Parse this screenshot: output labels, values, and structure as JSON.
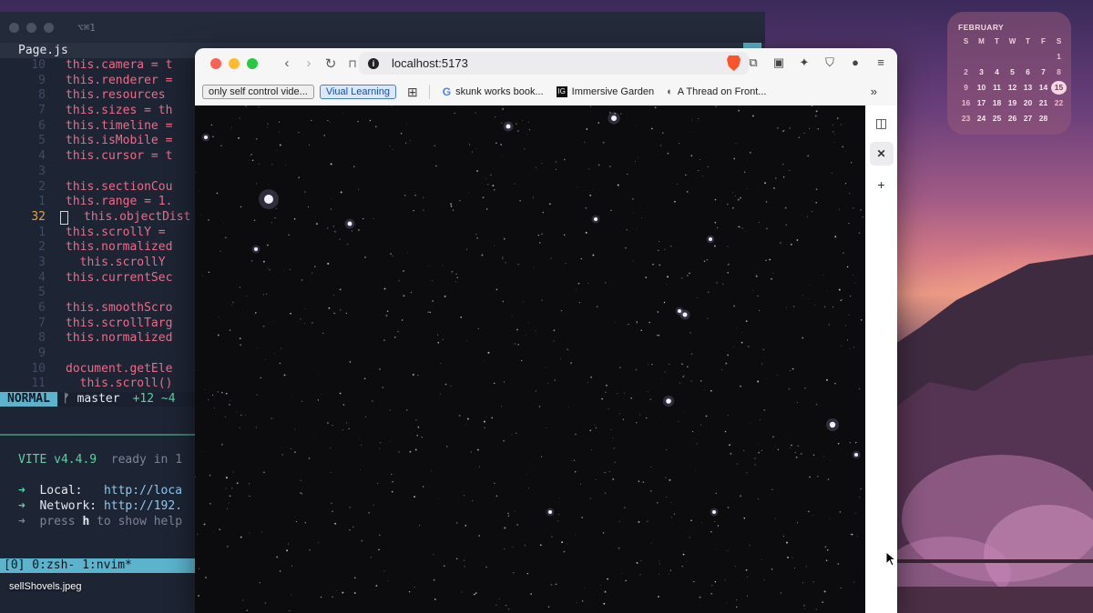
{
  "calendar": {
    "month": "FEBRUARY",
    "weekdays": [
      "S",
      "M",
      "T",
      "W",
      "T",
      "F",
      "S"
    ],
    "rows": [
      [
        "",
        "",
        "",
        "",
        "",
        "",
        "1"
      ],
      [
        "2",
        "3",
        "4",
        "5",
        "6",
        "7",
        "8"
      ],
      [
        "9",
        "10",
        "11",
        "12",
        "13",
        "14",
        "15"
      ],
      [
        "16",
        "17",
        "18",
        "19",
        "20",
        "21",
        "22"
      ],
      [
        "23",
        "24",
        "25",
        "26",
        "27",
        "28",
        ""
      ]
    ],
    "today": "15"
  },
  "terminal": {
    "title": "⌥⌘1",
    "tab": "Page.js",
    "lines": [
      {
        "num": "10",
        "sign": "",
        "code": "this.camera = t"
      },
      {
        "num": "9",
        "sign": "",
        "code": "this.renderer ="
      },
      {
        "num": "8",
        "sign": "",
        "code": "this.resources"
      },
      {
        "num": "7",
        "sign": "",
        "code": "this.sizes = th"
      },
      {
        "num": "6",
        "sign": "",
        "code": "this.timeline ="
      },
      {
        "num": "5",
        "sign": "",
        "code": "this.isMobile ="
      },
      {
        "num": "4",
        "sign": "",
        "code": "this.cursor = t"
      },
      {
        "num": "3",
        "sign": "",
        "code": ""
      },
      {
        "num": "2",
        "sign": "",
        "code": "this.sectionCou"
      },
      {
        "num": "1",
        "sign": "",
        "code": "this.range = 1."
      },
      {
        "num": "32",
        "sign": "",
        "code": "this.objectDist",
        "current": true
      },
      {
        "num": "1",
        "sign": "",
        "code": "this.scrollY ="
      },
      {
        "num": "2",
        "sign": "",
        "code": "this.normalized"
      },
      {
        "num": "3",
        "sign": "",
        "code": "  this.scrollY"
      },
      {
        "num": "4",
        "sign": "",
        "code": "this.currentSec"
      },
      {
        "num": "5",
        "sign": "",
        "code": ""
      },
      {
        "num": "6",
        "sign": "",
        "code": "this.smoothScro"
      },
      {
        "num": "7",
        "sign": "",
        "code": "this.scrollTarg"
      },
      {
        "num": "8",
        "sign": "",
        "code": "this.normalized"
      },
      {
        "num": "9",
        "sign": "",
        "code": ""
      },
      {
        "num": "10",
        "sign": "H",
        "code": "document.getEle"
      },
      {
        "num": "11",
        "sign": "",
        "code": "  this.scroll()"
      }
    ],
    "status": {
      "mode": "NORMAL",
      "branch": "ᚠ master",
      "diff": "+12 ~4"
    },
    "vite": {
      "name": "VITE v4.4.9",
      "ready": "ready in 1",
      "local_label": "Local:",
      "local_url": "http://loca",
      "network_label": "Network:",
      "network_url": "http://192.",
      "press_pre": "press ",
      "press_key": "h",
      "press_post": " to show help"
    },
    "tmux": "[0] 0:zsh- 1:nvim*"
  },
  "browser": {
    "url": "localhost:5173",
    "bookmarks": [
      {
        "label": "only self control vide...",
        "style": "pill"
      },
      {
        "label": "Viual Learning",
        "style": "pill-blue"
      },
      {
        "label": "skunk works book...",
        "icon": "G"
      },
      {
        "label": "Immersive Garden",
        "icon": "IG"
      },
      {
        "label": "A Thread on Front...",
        "icon": "◐"
      }
    ],
    "more": "»"
  },
  "desktop": {
    "file_label": "sellShovels.jpeg"
  }
}
